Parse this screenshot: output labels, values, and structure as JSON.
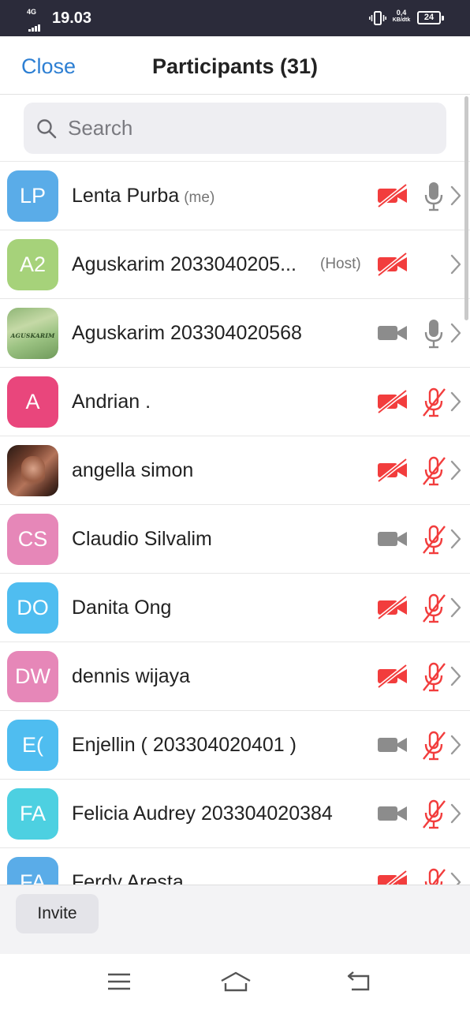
{
  "status_bar": {
    "network": "4G",
    "time": "19.03",
    "speed_value": "0,4",
    "speed_unit": "KB/dtk",
    "battery": "24"
  },
  "header": {
    "close_label": "Close",
    "title": "Participants (31)"
  },
  "search": {
    "placeholder": "Search"
  },
  "participants": [
    {
      "initials": "LP",
      "avatar_color": "#5aace8",
      "name": "Lenta Purba",
      "tag": "(me)",
      "video_on": false,
      "mic": "on"
    },
    {
      "initials": "A2",
      "avatar_color": "#a6d27a",
      "name": "Aguskarim 2033040205...",
      "tag": "(Host)",
      "video_on": false,
      "mic": "none"
    },
    {
      "initials": "",
      "avatar_image": "photo-aguskarim",
      "avatar_text": "AGUSKARIM",
      "name": "Aguskarim 203304020568",
      "tag": "",
      "video_on": true,
      "mic": "on"
    },
    {
      "initials": "A",
      "avatar_color": "#e9467c",
      "name": "Andrian .",
      "tag": "",
      "video_on": false,
      "mic": "muted"
    },
    {
      "initials": "",
      "avatar_image": "photo-angella",
      "name": "angella simon",
      "tag": "",
      "video_on": false,
      "mic": "muted"
    },
    {
      "initials": "CS",
      "avatar_color": "#e687b8",
      "name": "Claudio Silvalim",
      "tag": "",
      "video_on": true,
      "mic": "muted"
    },
    {
      "initials": "DO",
      "avatar_color": "#4fbdf0",
      "name": "Danita Ong",
      "tag": "",
      "video_on": false,
      "mic": "muted"
    },
    {
      "initials": "DW",
      "avatar_color": "#e687b8",
      "name": "dennis wijaya",
      "tag": "",
      "video_on": false,
      "mic": "muted"
    },
    {
      "initials": "E(",
      "avatar_color": "#4fbdf0",
      "name": "Enjellin ( 203304020401 )",
      "tag": "",
      "video_on": true,
      "mic": "muted"
    },
    {
      "initials": "FA",
      "avatar_color": "#4dd0e1",
      "name": "Felicia Audrey 203304020384",
      "tag": "",
      "video_on": true,
      "mic": "muted"
    },
    {
      "initials": "FA",
      "avatar_color": "#5aace8",
      "name": "Ferdy Aresta",
      "tag": "",
      "video_on": false,
      "mic": "muted"
    }
  ],
  "footer": {
    "invite_label": "Invite"
  },
  "colors": {
    "accent": "#2d7fd3",
    "muted_red": "#f23d3d",
    "icon_gray": "#8c8c8c"
  }
}
